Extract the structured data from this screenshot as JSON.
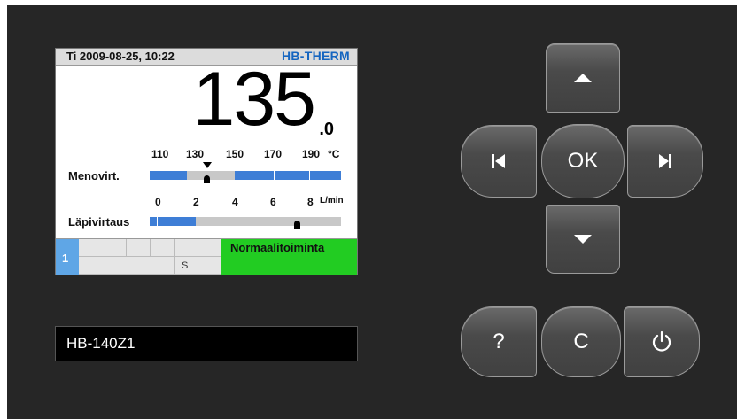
{
  "lcd": {
    "datetime": "Ti 2009-08-25, 10:22",
    "logo": "HB-THERM",
    "temperature_main": "135",
    "temperature_decimal": ".0",
    "temperature_scale": {
      "labels": [
        "110",
        "130",
        "150",
        "170",
        "190"
      ],
      "unit": "°C"
    },
    "supply_temp_label": "Menovirt.",
    "flow_scale": {
      "labels": [
        "0",
        "2",
        "4",
        "6",
        "8"
      ],
      "unit": "L/min"
    },
    "flow_label": "Läpivirtaus",
    "status_number": "1",
    "status_grid_symbol": "S",
    "status_mode": "Normaalitoiminta"
  },
  "model": {
    "name": "HB-140Z1"
  },
  "keys": {
    "up": "up-arrow-icon",
    "down": "down-arrow-icon",
    "prev": "skip-back-icon",
    "next": "skip-forward-icon",
    "ok": "OK",
    "help": "?",
    "clear": "C",
    "power": "power-icon"
  },
  "colors": {
    "panel": "#262626",
    "accent_blue": "#3e7ed6",
    "status_green": "#22cc22",
    "status_blue": "#5fa6e6",
    "logo_blue": "#1565c0"
  }
}
